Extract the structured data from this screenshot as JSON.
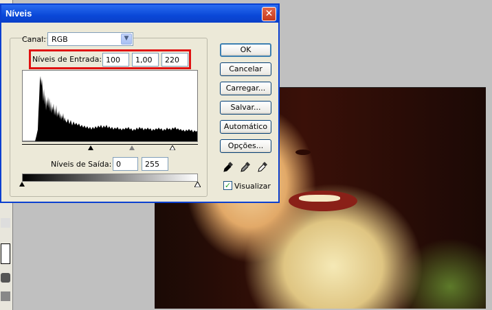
{
  "dialog": {
    "title": "Níveis",
    "close_glyph": "✕",
    "channel": {
      "label": "Canal:",
      "value": "RGB"
    },
    "input_levels": {
      "label": "Níveis de Entrada:",
      "black": "100",
      "gamma": "1,00",
      "white": "220"
    },
    "output_levels": {
      "label": "Níveis de Saída:",
      "black": "0",
      "white": "255"
    },
    "buttons": {
      "ok": "OK",
      "cancel": "Cancelar",
      "load": "Carregar...",
      "save": "Salvar...",
      "auto": "Automático",
      "options": "Opções..."
    },
    "preview": {
      "label": "Visualizar",
      "checked": true
    }
  },
  "colors": {
    "title_bar": "#0a48d8",
    "dialog_bg": "#ece9d8",
    "highlight": "#e01010",
    "close_button": "#c7391b"
  },
  "icons": [
    "black-eyedropper-icon",
    "gray-eyedropper-icon",
    "white-eyedropper-icon",
    "close-icon",
    "chevron-down-icon"
  ]
}
